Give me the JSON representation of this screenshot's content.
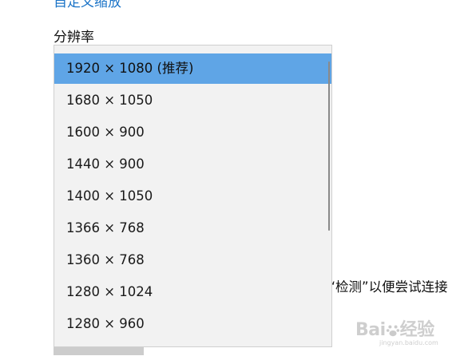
{
  "header": {
    "top_link": "自定义缩放",
    "resolution_label": "分辨率"
  },
  "resolution_dropdown": {
    "selected": "1920 × 1080 (推荐)",
    "options": [
      "1920 × 1080 (推荐)",
      "1680 × 1050",
      "1600 × 900",
      "1440 × 900",
      "1400 × 1050",
      "1366 × 768",
      "1360 × 768",
      "1280 × 1024",
      "1280 × 960"
    ]
  },
  "background": {
    "hint_text": "择“检测”以便尝试连接"
  },
  "watermark": {
    "logo_text": "Bai",
    "logo_text2": "经验",
    "sub_text": "jingyan.baidu.com"
  },
  "colors": {
    "selected_bg": "#5fa5e6",
    "dropdown_bg": "#f2f2f2",
    "link": "#1a73c7"
  }
}
